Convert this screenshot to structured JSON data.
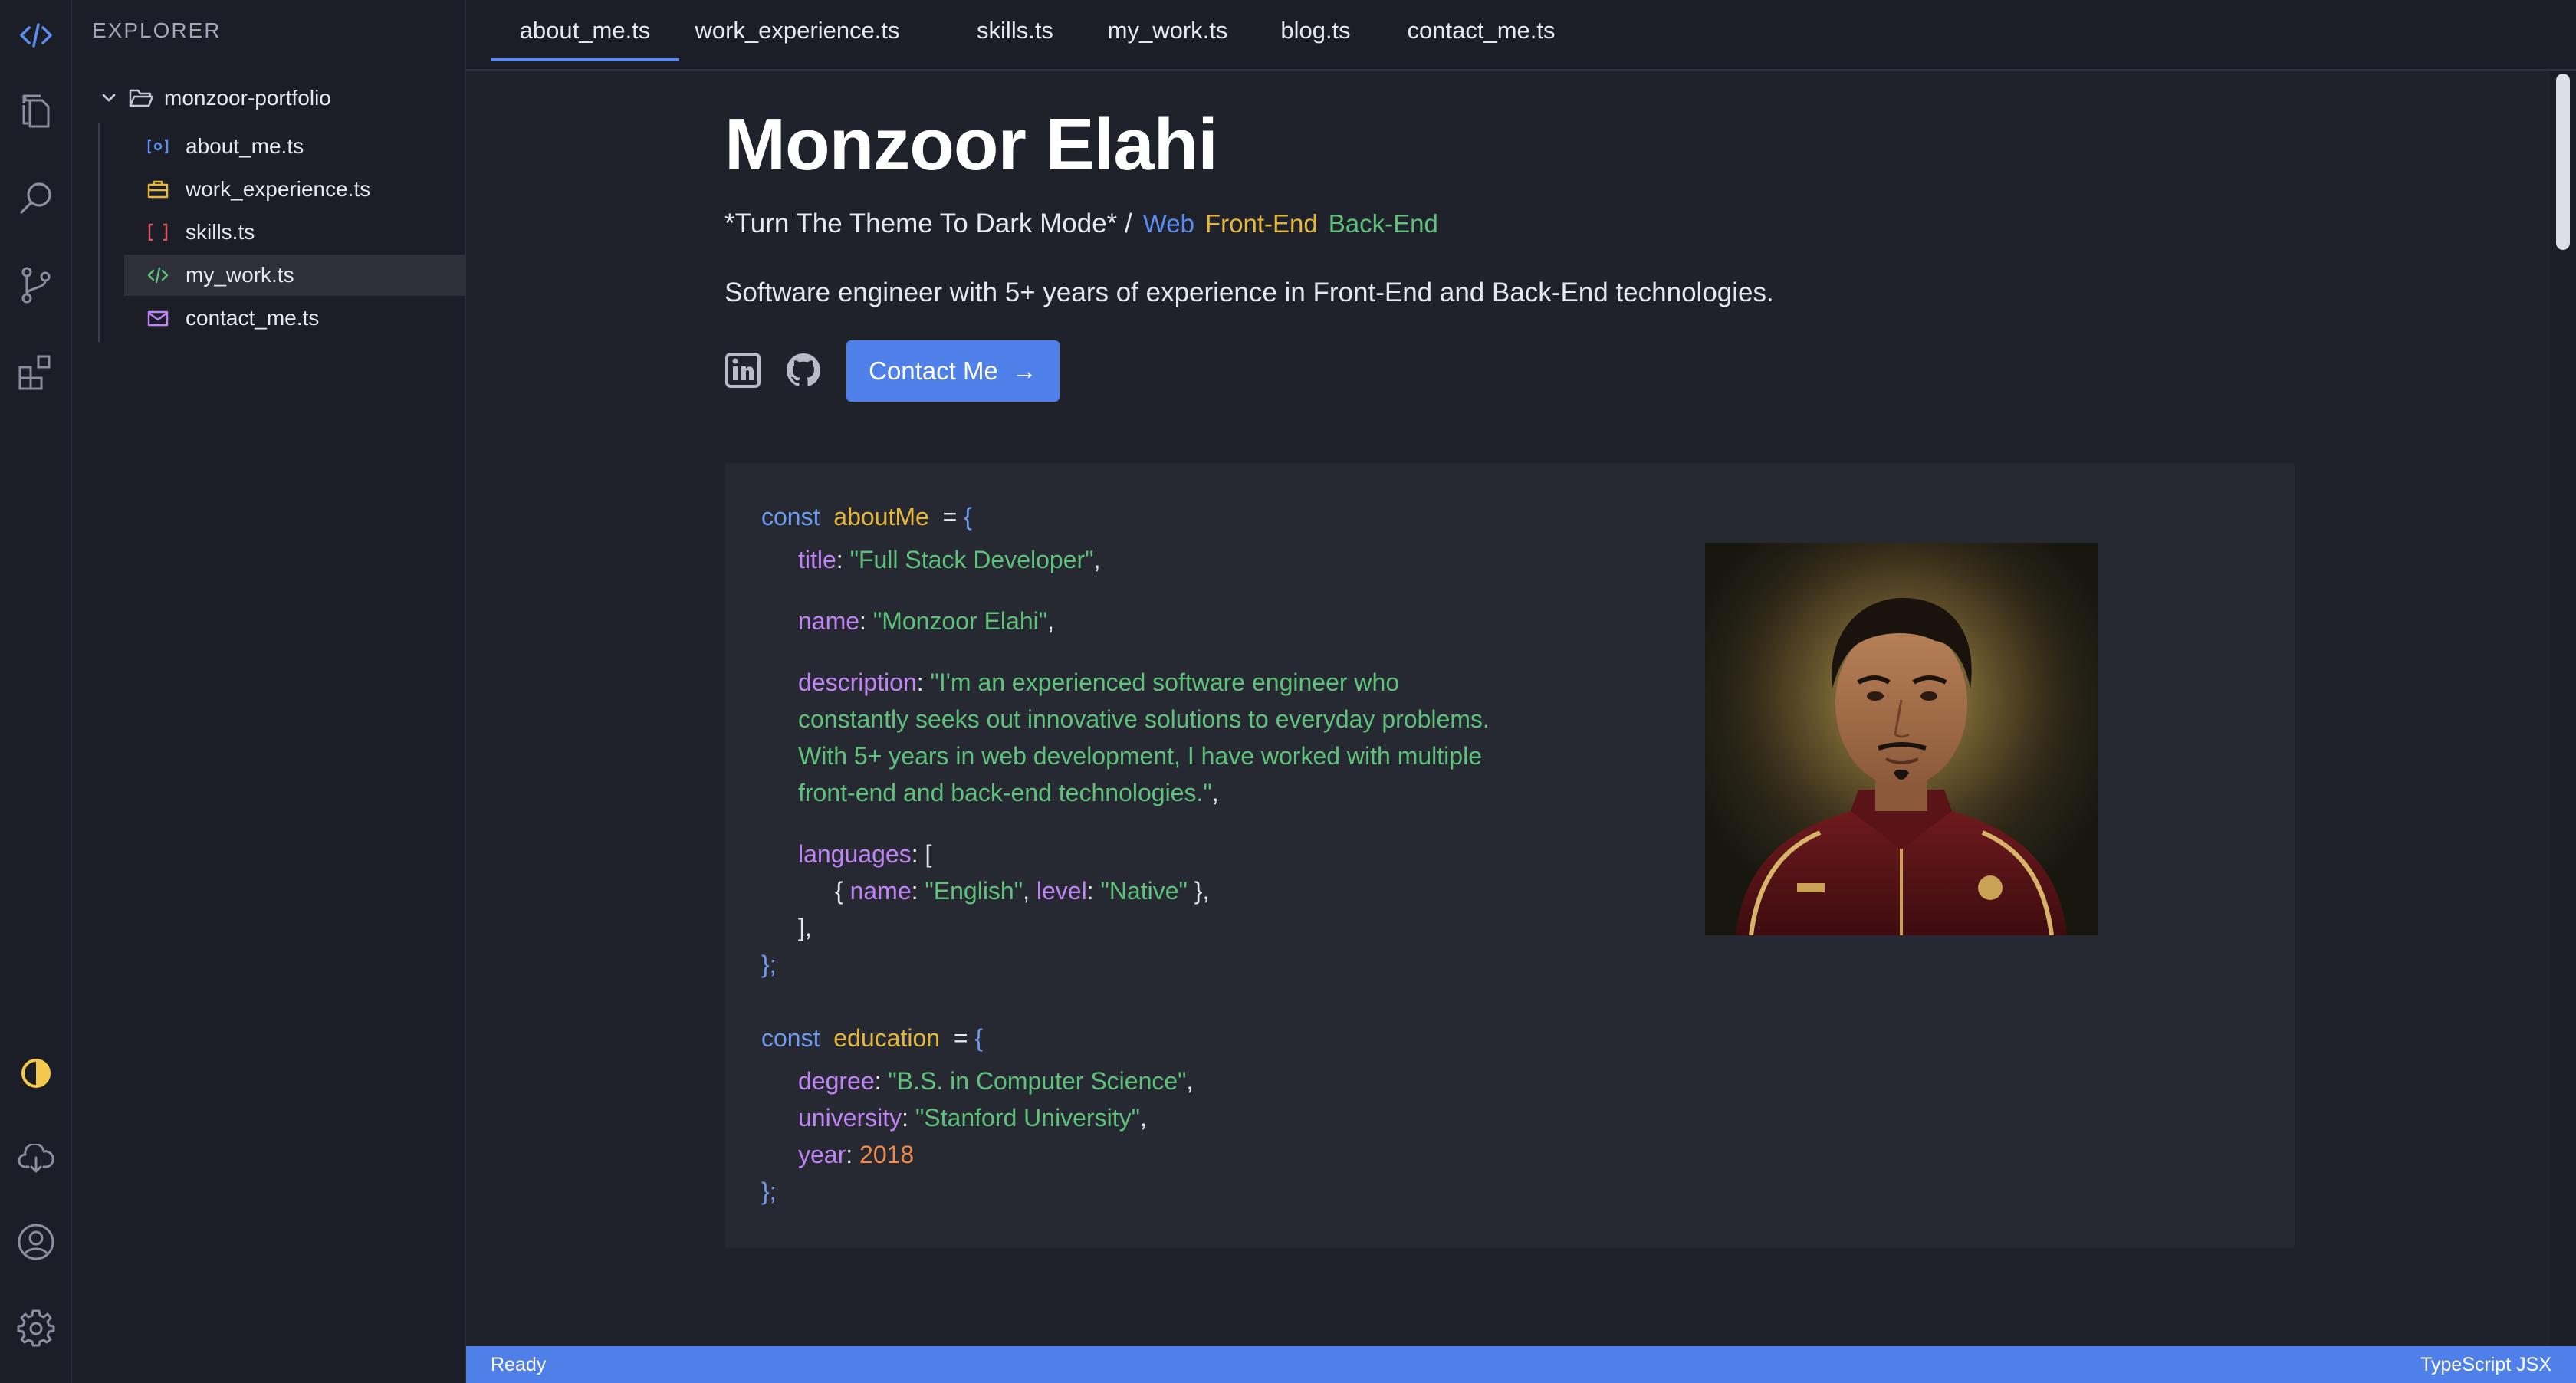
{
  "explorer": {
    "title": "EXPLORER",
    "folder": "monzoor-portfolio",
    "files": [
      {
        "label": "about_me.ts"
      },
      {
        "label": "work_experience.ts"
      },
      {
        "label": "skills.ts"
      },
      {
        "label": "my_work.ts"
      },
      {
        "label": "contact_me.ts"
      }
    ]
  },
  "tabs": [
    {
      "label": "about_me.ts"
    },
    {
      "label": "work_experience.ts"
    },
    {
      "label": "skills.ts"
    },
    {
      "label": "my_work.ts"
    },
    {
      "label": "blog.ts"
    },
    {
      "label": "contact_me.ts"
    }
  ],
  "hero": {
    "name": "Monzoor Elahi",
    "tagline_lead": "*Turn The Theme To Dark Mode* /",
    "tag_web": "Web",
    "tag_frontend": "Front-End",
    "tag_backend": "Back-End",
    "summary": "Software engineer with 5+ years of experience in Front-End and Back-End technologies.",
    "contact_label": "Contact Me",
    "contact_arrow": "→"
  },
  "code": {
    "const": "const",
    "eq": "=",
    "open_brace": "{",
    "close_brace": "};",
    "about_var": "aboutMe",
    "title_key": "title",
    "title_val": "\"Full Stack Developer\"",
    "name_key": "name",
    "name_val": "\"Monzoor Elahi\"",
    "desc_key": "description",
    "desc_line1": "\"I'm an experienced software engineer who",
    "desc_line2": "constantly seeks out innovative solutions to everyday problems.",
    "desc_line3": "With 5+ years in web development, I have worked with multiple",
    "desc_line4": "front-end and back-end technologies.\"",
    "languages_key": "languages",
    "open_bracket": "[",
    "close_bracket": "],",
    "lang_name_key": "name",
    "lang_name_val": "\"English\"",
    "lang_level_key": "level",
    "lang_level_val": "\"Native\"",
    "edu_var": "education",
    "degree_key": "degree",
    "degree_val": "\"B.S. in Computer Science\"",
    "univ_key": "university",
    "univ_val": "\"Stanford University\"",
    "year_key": "year",
    "year_val": "2018"
  },
  "status": {
    "left": "Ready",
    "right": "TypeScript JSX"
  },
  "colors": {
    "accent": "#4f80ea",
    "keyword": "#6d9cf2",
    "variable": "#e5b73b",
    "property": "#c084f5",
    "string": "#5ec27a",
    "number": "#f08a4b"
  }
}
